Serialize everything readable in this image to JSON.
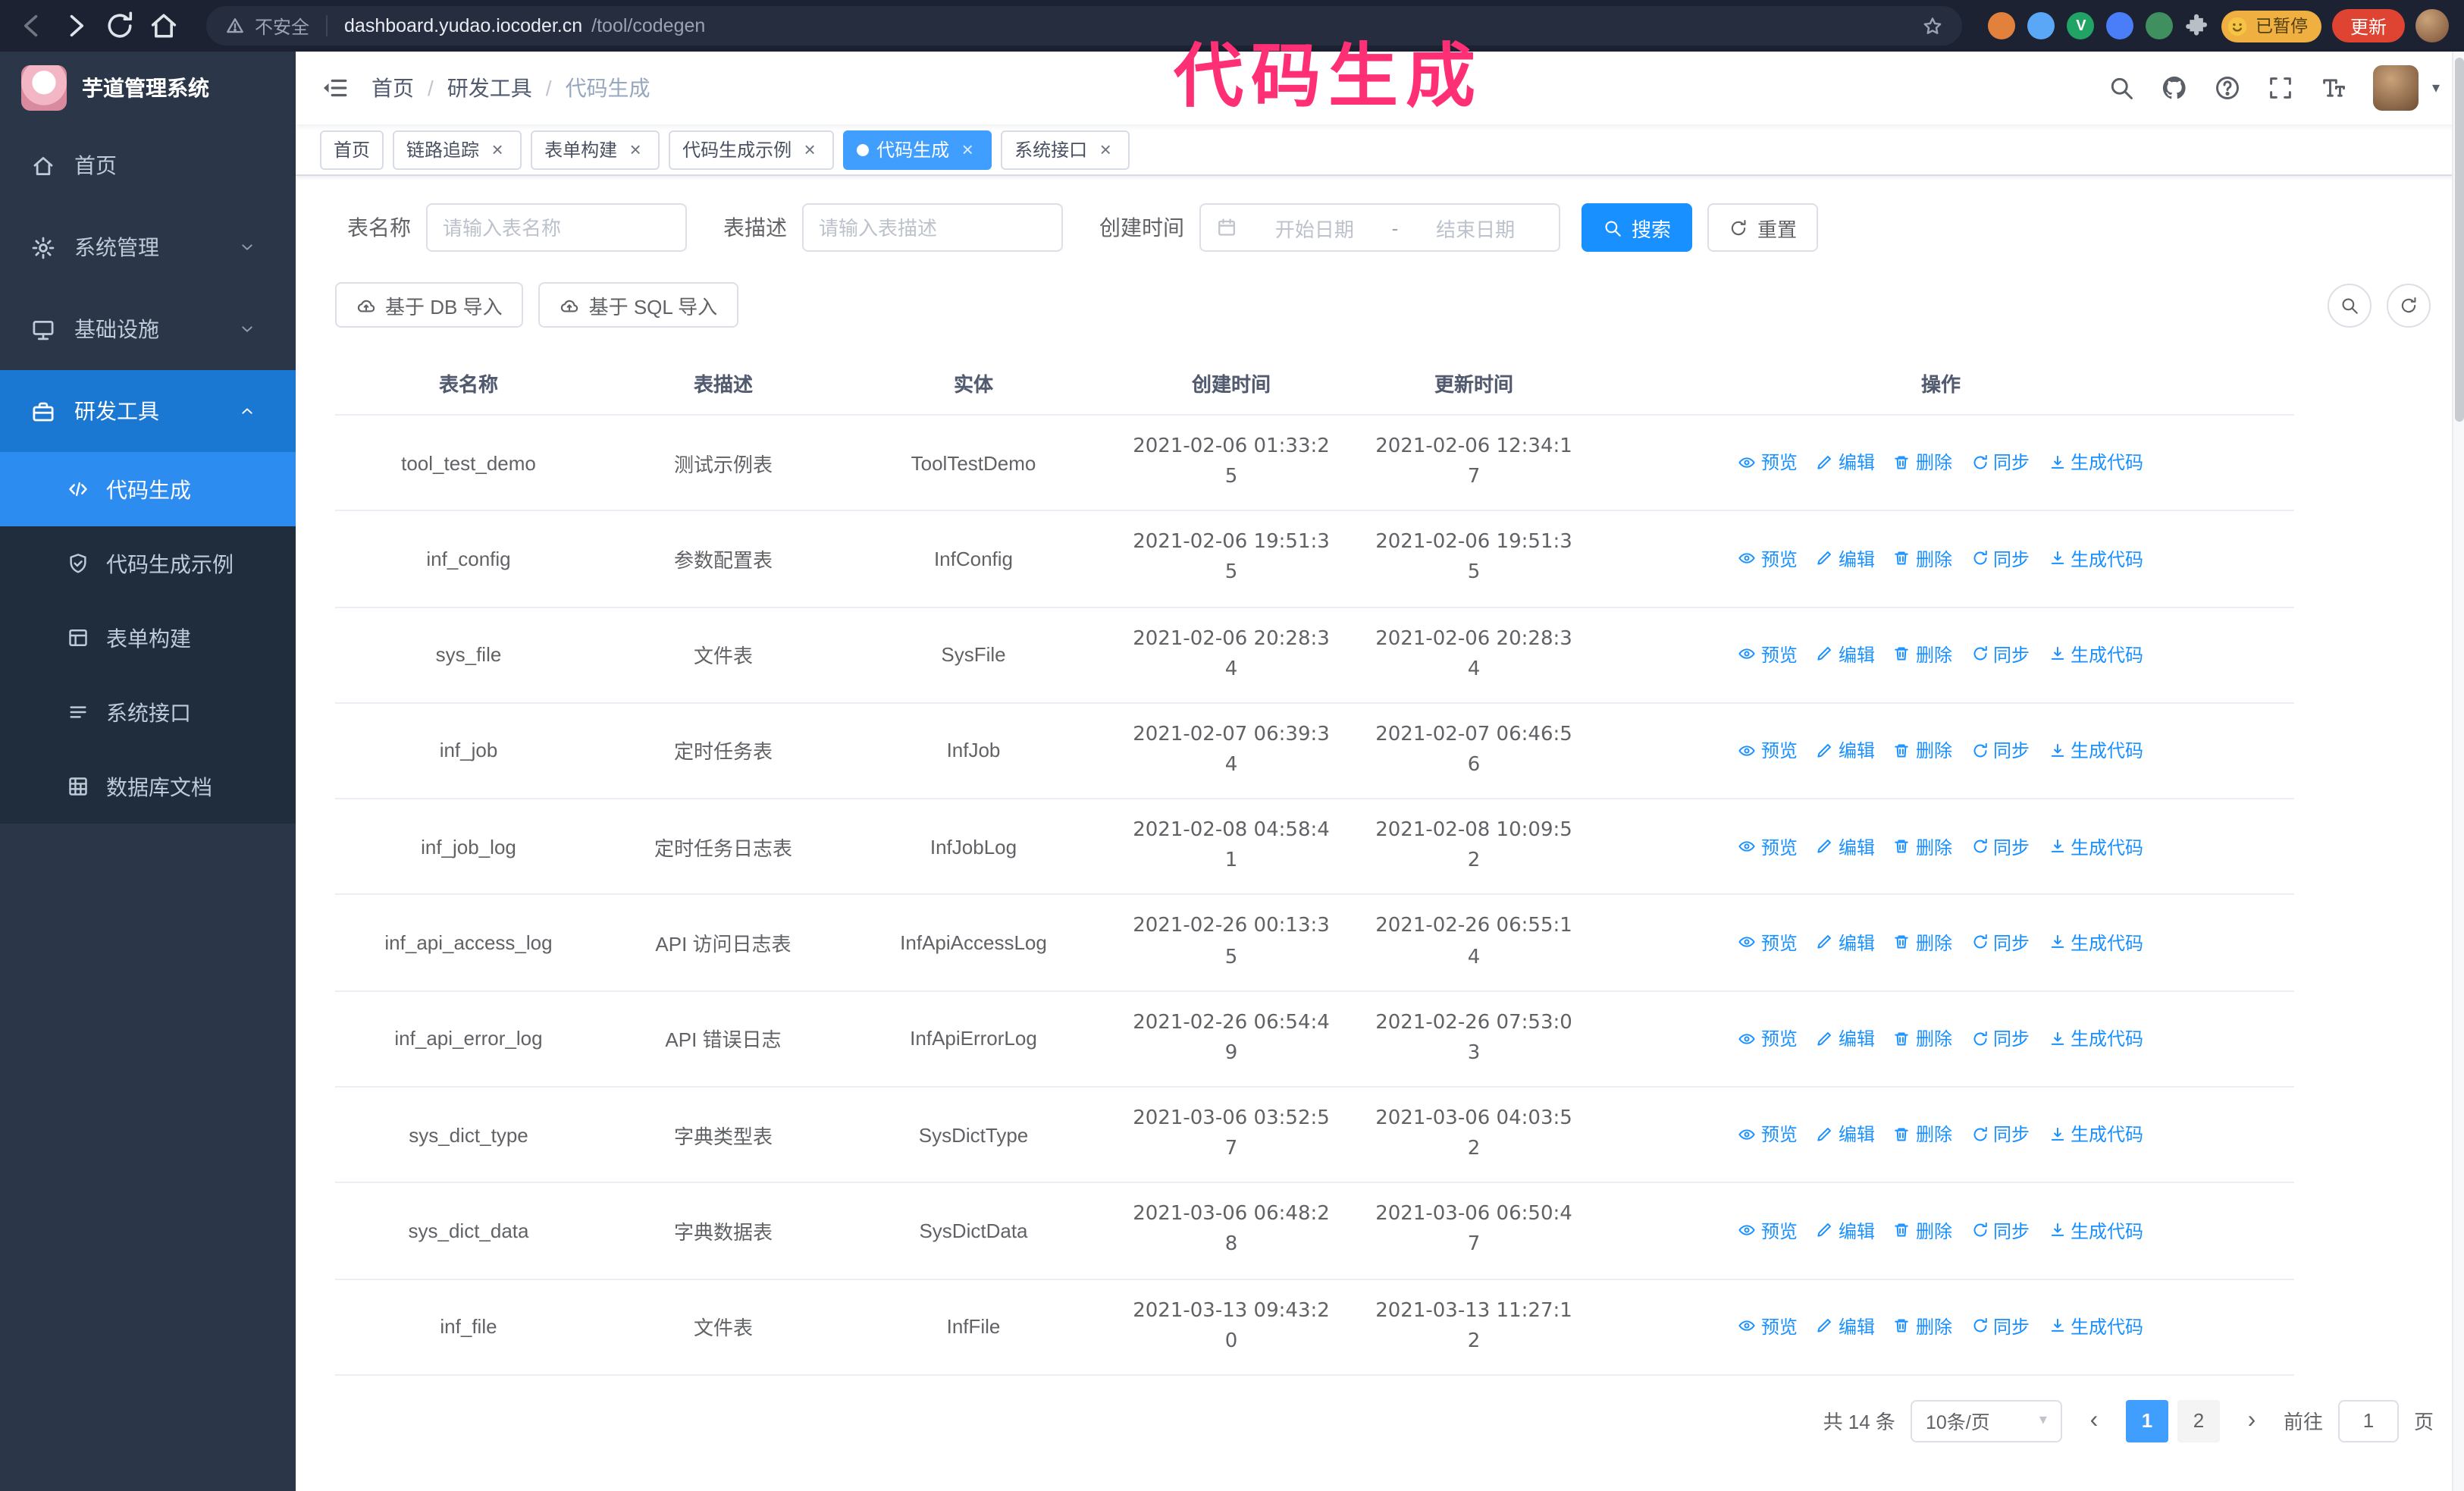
{
  "annotation": {
    "text": "代码生成"
  },
  "browser": {
    "security_label": "不安全",
    "url_host": "dashboard.yudao.iocoder.cn",
    "url_path": "/tool/codegen",
    "paused_badge": "已暂停",
    "update_button": "更新",
    "extensions": [
      {
        "color": "#e2813b"
      },
      {
        "color": "#5aa7f7"
      },
      {
        "color": "#21a366",
        "glyph": "V"
      },
      {
        "color": "#4a7df8"
      },
      {
        "color": "#3f8f5f"
      }
    ]
  },
  "sidebar": {
    "logo_title": "芋道管理系统",
    "menu": [
      {
        "label": "首页",
        "icon": "home-icon",
        "expandable": false,
        "expanded": false,
        "active": false
      },
      {
        "label": "系统管理",
        "icon": "gear-icon",
        "expandable": true,
        "expanded": false,
        "active": false
      },
      {
        "label": "基础设施",
        "icon": "infra-icon",
        "expandable": true,
        "expanded": false,
        "active": false
      },
      {
        "label": "研发工具",
        "icon": "tools-icon",
        "expandable": true,
        "expanded": true,
        "active": true
      }
    ],
    "submenu": [
      {
        "label": "代码生成",
        "icon": "code-icon",
        "active": true
      },
      {
        "label": "代码生成示例",
        "icon": "example-icon",
        "active": false
      },
      {
        "label": "表单构建",
        "icon": "form-icon",
        "active": false
      },
      {
        "label": "系统接口",
        "icon": "api-icon",
        "active": false
      },
      {
        "label": "数据库文档",
        "icon": "db-icon",
        "active": false
      }
    ]
  },
  "header": {
    "breadcrumb": [
      "首页",
      "研发工具",
      "代码生成"
    ]
  },
  "tabs": [
    {
      "label": "首页",
      "closable": false,
      "active": false
    },
    {
      "label": "链路追踪",
      "closable": true,
      "active": false
    },
    {
      "label": "表单构建",
      "closable": true,
      "active": false
    },
    {
      "label": "代码生成示例",
      "closable": true,
      "active": false
    },
    {
      "label": "代码生成",
      "closable": true,
      "active": true
    },
    {
      "label": "系统接口",
      "closable": true,
      "active": false
    }
  ],
  "filters": {
    "table_name_label": "表名称",
    "table_name_placeholder": "请输入表名称",
    "table_desc_label": "表描述",
    "table_desc_placeholder": "请输入表描述",
    "create_time_label": "创建时间",
    "date_start_placeholder": "开始日期",
    "date_separator": "-",
    "date_end_placeholder": "结束日期",
    "search_button": "搜索",
    "reset_button": "重置"
  },
  "toolbar": {
    "import_db": "基于 DB 导入",
    "import_sql": "基于 SQL 导入"
  },
  "table": {
    "columns": [
      "表名称",
      "表描述",
      "实体",
      "创建时间",
      "更新时间",
      "操作"
    ],
    "row_actions": [
      {
        "label": "预览",
        "icon": "eye-icon",
        "name": "preview-link"
      },
      {
        "label": "编辑",
        "icon": "pencil-icon",
        "name": "edit-link"
      },
      {
        "label": "删除",
        "icon": "trash-icon",
        "name": "delete-link"
      },
      {
        "label": "同步",
        "icon": "sync-icon",
        "name": "sync-link"
      },
      {
        "label": "生成代码",
        "icon": "download-icon",
        "name": "generate-code-link"
      }
    ],
    "rows": [
      {
        "name": "tool_test_demo",
        "desc": "测试示例表",
        "entity": "ToolTestDemo",
        "created": "2021-02-06 01:33:25",
        "updated": "2021-02-06 12:34:17"
      },
      {
        "name": "inf_config",
        "desc": "参数配置表",
        "entity": "InfConfig",
        "created": "2021-02-06 19:51:35",
        "updated": "2021-02-06 19:51:35"
      },
      {
        "name": "sys_file",
        "desc": "文件表",
        "entity": "SysFile",
        "created": "2021-02-06 20:28:34",
        "updated": "2021-02-06 20:28:34"
      },
      {
        "name": "inf_job",
        "desc": "定时任务表",
        "entity": "InfJob",
        "created": "2021-02-07 06:39:34",
        "updated": "2021-02-07 06:46:56"
      },
      {
        "name": "inf_job_log",
        "desc": "定时任务日志表",
        "entity": "InfJobLog",
        "created": "2021-02-08 04:58:41",
        "updated": "2021-02-08 10:09:52"
      },
      {
        "name": "inf_api_access_log",
        "desc": "API 访问日志表",
        "entity": "InfApiAccessLog",
        "created": "2021-02-26 00:13:35",
        "updated": "2021-02-26 06:55:14"
      },
      {
        "name": "inf_api_error_log",
        "desc": "API 错误日志",
        "entity": "InfApiErrorLog",
        "created": "2021-02-26 06:54:49",
        "updated": "2021-02-26 07:53:03"
      },
      {
        "name": "sys_dict_type",
        "desc": "字典类型表",
        "entity": "SysDictType",
        "created": "2021-03-06 03:52:57",
        "updated": "2021-03-06 04:03:52"
      },
      {
        "name": "sys_dict_data",
        "desc": "字典数据表",
        "entity": "SysDictData",
        "created": "2021-03-06 06:48:28",
        "updated": "2021-03-06 06:50:47"
      },
      {
        "name": "inf_file",
        "desc": "文件表",
        "entity": "InfFile",
        "created": "2021-03-13 09:43:20",
        "updated": "2021-03-13 11:27:12"
      }
    ]
  },
  "pagination": {
    "total": "共 14 条",
    "page_size": "10条/页",
    "pages": [
      {
        "label": "1",
        "active": true
      },
      {
        "label": "2",
        "active": false
      }
    ],
    "goto_label": "前往",
    "goto_value": "1",
    "goto_suffix": "页"
  },
  "colors": {
    "accent": "#1890ff",
    "active_tab": "#409eff",
    "annotation_pink": "#ff2f76",
    "update_red": "#df4432",
    "paused_yellow": "#efb041",
    "sidebar_bg": "#2b3648",
    "submenu_bg": "#1f2d3d",
    "chrome_bg": "#1c2231"
  }
}
